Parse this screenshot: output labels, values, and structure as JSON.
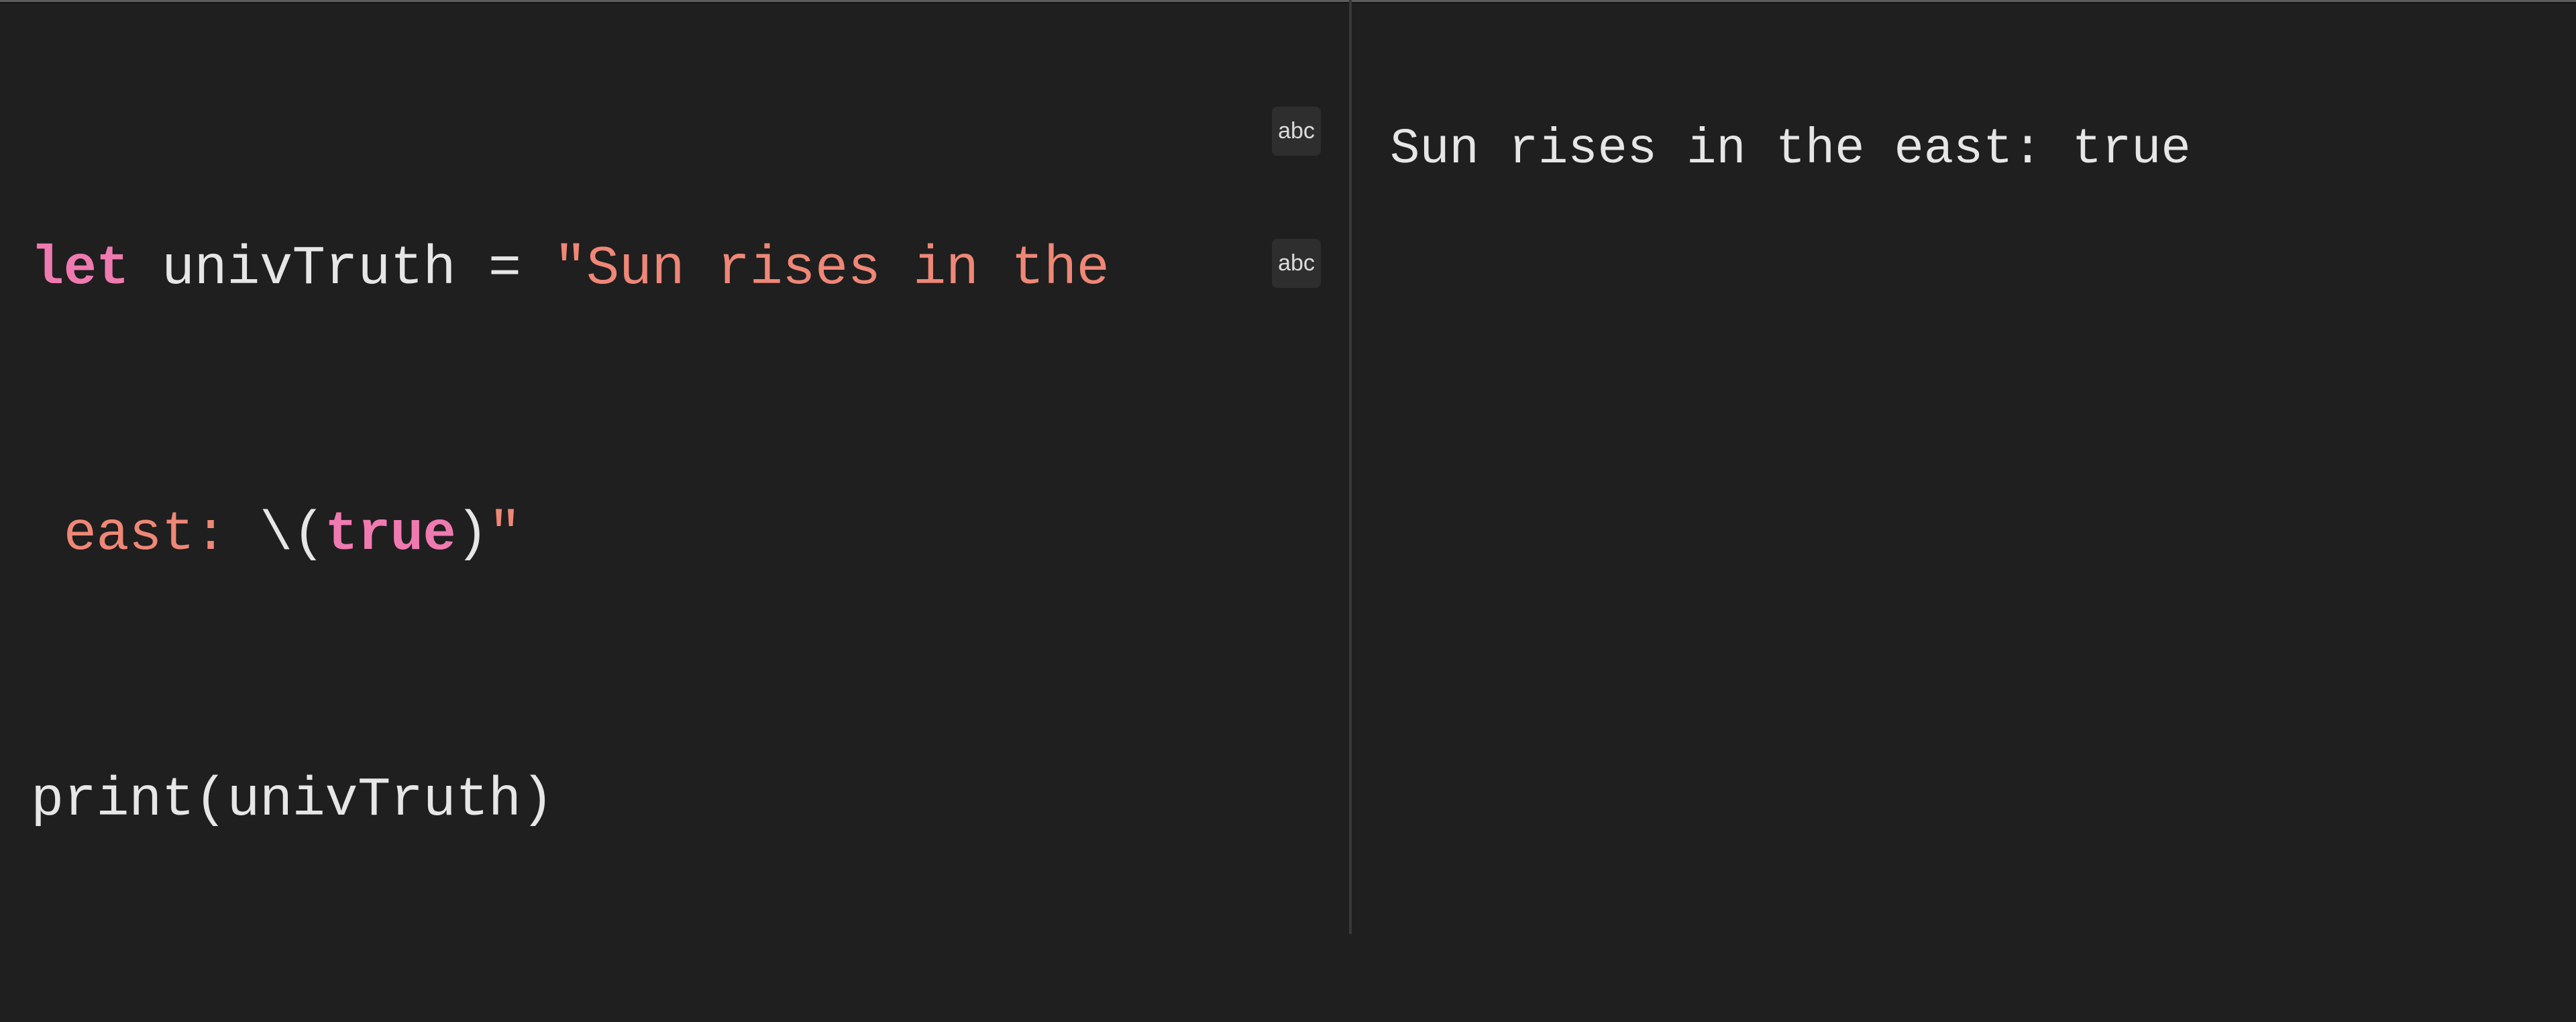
{
  "editor": {
    "lines": [
      {
        "tokens": [
          {
            "type": "keyword",
            "text": "let"
          },
          {
            "type": "plain",
            "text": " univTruth = "
          },
          {
            "type": "string",
            "text": "\"Sun rises in the"
          }
        ]
      },
      {
        "tokens": [
          {
            "type": "string",
            "text": " east: "
          },
          {
            "type": "plain",
            "text": "\\("
          },
          {
            "type": "keyword",
            "text": "true"
          },
          {
            "type": "plain",
            "text": ")"
          },
          {
            "type": "string",
            "text": "\""
          }
        ]
      },
      {
        "tokens": [
          {
            "type": "plain",
            "text": "print(univTruth)"
          }
        ]
      }
    ],
    "result_badges": [
      {
        "label": "abc",
        "icon": "string-result-icon"
      },
      {
        "label": "abc",
        "icon": "string-result-icon"
      }
    ]
  },
  "results": {
    "output": "Sun rises in the east: true"
  },
  "colors": {
    "background": "#1f1f1f",
    "keyword": "#ef7ab0",
    "string": "#ef8777",
    "plain": "#e6e6e6"
  }
}
